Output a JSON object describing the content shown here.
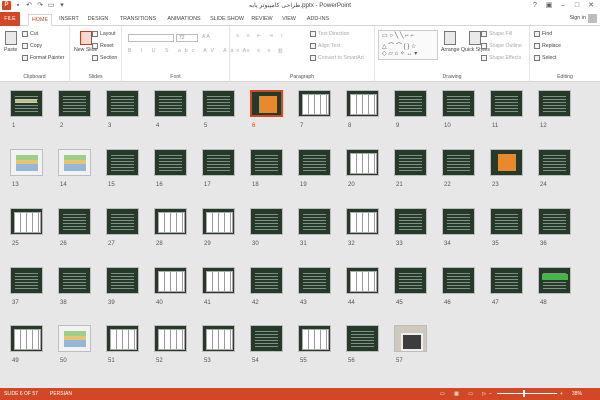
{
  "window": {
    "title": "طراحی کامپیوتر پایه.pptx - PowerPoint"
  },
  "account": {
    "signin": "Sign in"
  },
  "tabs": [
    "FILE",
    "HOME",
    "INSERT",
    "DESIGN",
    "TRANSITIONS",
    "ANIMATIONS",
    "SLIDE SHOW",
    "REVIEW",
    "VIEW",
    "ADD-INS"
  ],
  "ribbon": {
    "clipboard": {
      "label": "Clipboard",
      "paste": "Paste",
      "cut": "Cut",
      "copy": "Copy",
      "format_painter": "Format Painter"
    },
    "slides": {
      "label": "Slides",
      "new_slide": "New Slide",
      "layout": "Layout",
      "reset": "Reset",
      "section": "Section"
    },
    "font": {
      "label": "Font",
      "size": "72"
    },
    "paragraph": {
      "label": "Paragraph",
      "text_direction": "Text Direction",
      "align_text": "Align Text",
      "smartart": "Convert to SmartArt"
    },
    "drawing": {
      "label": "Drawing",
      "arrange": "Arrange",
      "quick_styles": "Quick Styles",
      "shape_fill": "Shape Fill",
      "shape_outline": "Shape Outline",
      "shape_effects": "Shape Effects"
    },
    "editing": {
      "label": "Editing",
      "find": "Find",
      "replace": "Replace",
      "select": "Select"
    }
  },
  "slides": [
    {
      "n": "1",
      "type": "title-slide"
    },
    {
      "n": "2",
      "type": "text"
    },
    {
      "n": "3",
      "type": "text"
    },
    {
      "n": "4",
      "type": "text"
    },
    {
      "n": "5",
      "type": "text"
    },
    {
      "n": "6",
      "type": "orange",
      "selected": true
    },
    {
      "n": "7",
      "type": "table"
    },
    {
      "n": "8",
      "type": "table"
    },
    {
      "n": "9",
      "type": "text"
    },
    {
      "n": "10",
      "type": "text"
    },
    {
      "n": "11",
      "type": "text"
    },
    {
      "n": "12",
      "type": "text"
    },
    {
      "n": "13",
      "type": "white"
    },
    {
      "n": "14",
      "type": "white"
    },
    {
      "n": "15",
      "type": "text"
    },
    {
      "n": "16",
      "type": "text"
    },
    {
      "n": "17",
      "type": "text"
    },
    {
      "n": "18",
      "type": "text"
    },
    {
      "n": "19",
      "type": "text"
    },
    {
      "n": "20",
      "type": "table"
    },
    {
      "n": "21",
      "type": "text"
    },
    {
      "n": "22",
      "type": "text"
    },
    {
      "n": "23",
      "type": "orange"
    },
    {
      "n": "24",
      "type": "text"
    },
    {
      "n": "25",
      "type": "table"
    },
    {
      "n": "26",
      "type": "text"
    },
    {
      "n": "27",
      "type": "text"
    },
    {
      "n": "28",
      "type": "table"
    },
    {
      "n": "29",
      "type": "table"
    },
    {
      "n": "30",
      "type": "text"
    },
    {
      "n": "31",
      "type": "text"
    },
    {
      "n": "32",
      "type": "table"
    },
    {
      "n": "33",
      "type": "text"
    },
    {
      "n": "34",
      "type": "text"
    },
    {
      "n": "35",
      "type": "text"
    },
    {
      "n": "36",
      "type": "text"
    },
    {
      "n": "37",
      "type": "text"
    },
    {
      "n": "38",
      "type": "text"
    },
    {
      "n": "39",
      "type": "text"
    },
    {
      "n": "40",
      "type": "table"
    },
    {
      "n": "41",
      "type": "table"
    },
    {
      "n": "42",
      "type": "text"
    },
    {
      "n": "43",
      "type": "text"
    },
    {
      "n": "44",
      "type": "table"
    },
    {
      "n": "45",
      "type": "text"
    },
    {
      "n": "46",
      "type": "text"
    },
    {
      "n": "47",
      "type": "text"
    },
    {
      "n": "48",
      "type": "green"
    },
    {
      "n": "49",
      "type": "table"
    },
    {
      "n": "50",
      "type": "white"
    },
    {
      "n": "51",
      "type": "table"
    },
    {
      "n": "52",
      "type": "table"
    },
    {
      "n": "53",
      "type": "table"
    },
    {
      "n": "54",
      "type": "text"
    },
    {
      "n": "55",
      "type": "table"
    },
    {
      "n": "56",
      "type": "text"
    },
    {
      "n": "57",
      "type": "photo"
    }
  ],
  "status": {
    "slide_info": "SLIDE 6 OF 57",
    "language": "PERSIAN",
    "zoom": "38%"
  }
}
